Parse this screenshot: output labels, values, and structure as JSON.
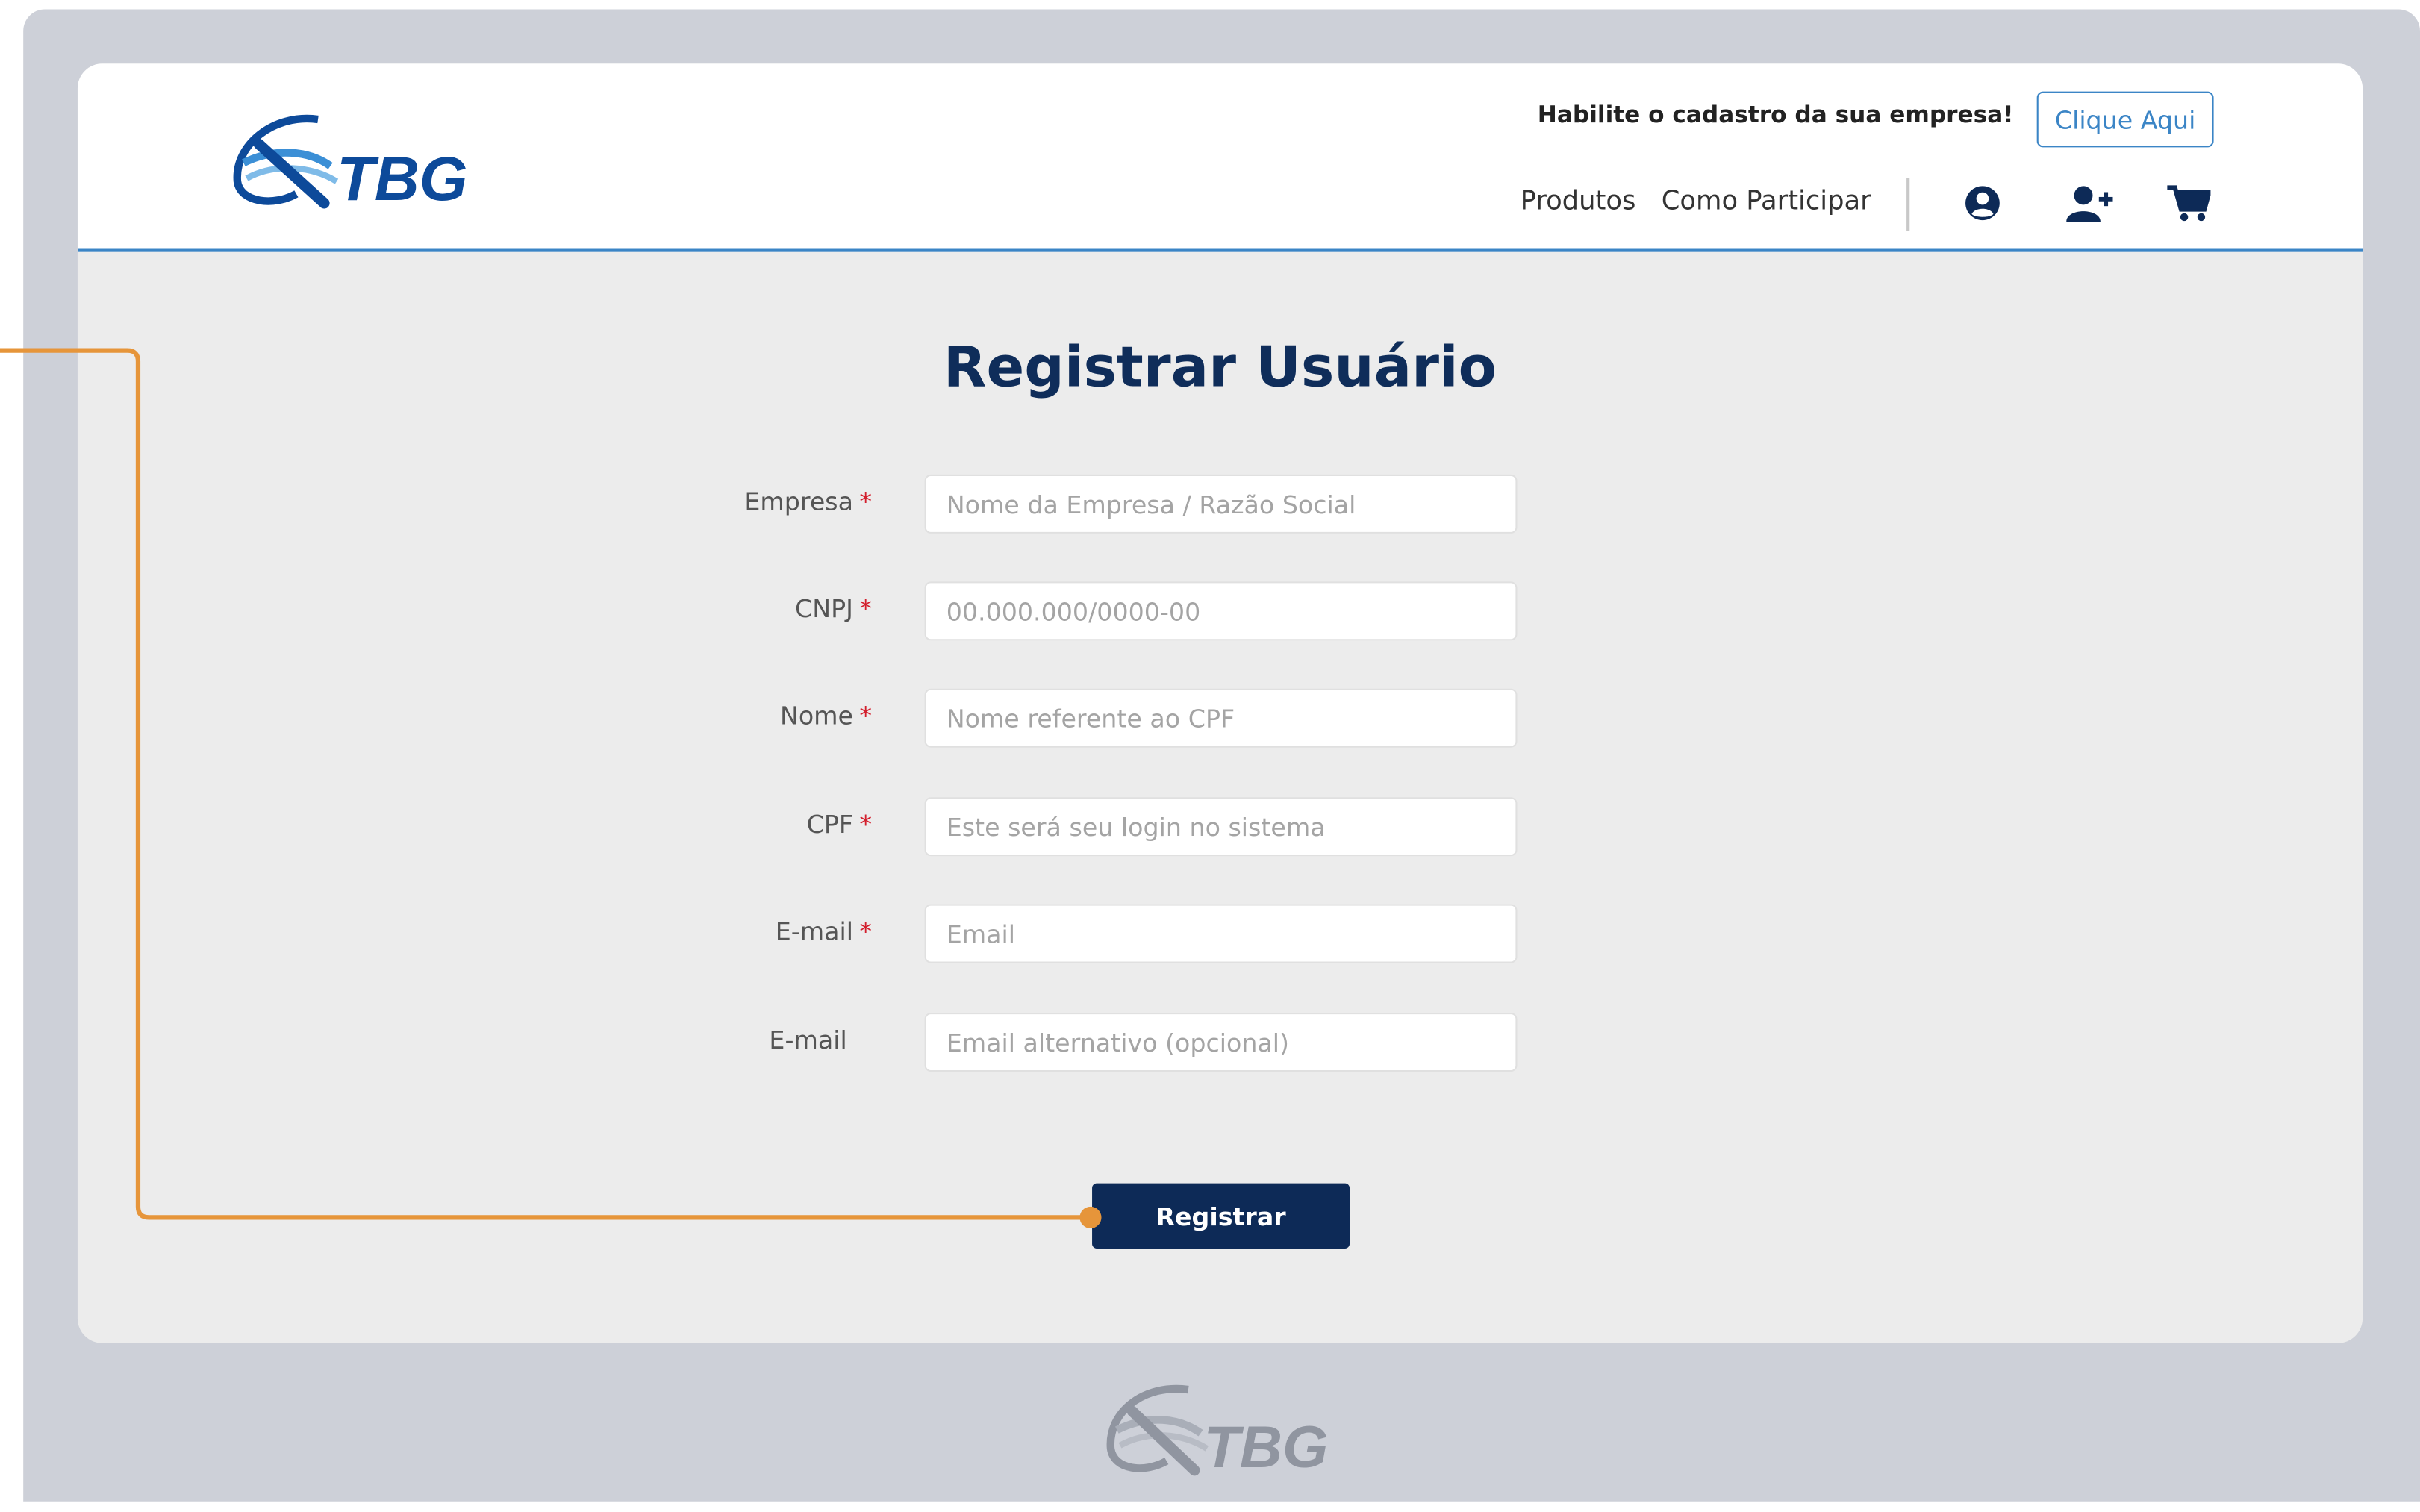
{
  "header": {
    "logo_text": "TBG",
    "promo_text": "Habilite o cadastro da sua empresa!",
    "promo_button": "Clique Aqui",
    "nav": [
      "Produtos",
      "Como Participar"
    ],
    "icons": [
      "user-circle-icon",
      "user-plus-icon",
      "cart-icon"
    ]
  },
  "form": {
    "title": "Registrar Usuário",
    "fields": [
      {
        "label": "Empresa",
        "required": true,
        "placeholder": "Nome da Empresa / Razão Social",
        "value": ""
      },
      {
        "label": "CNPJ",
        "required": true,
        "placeholder": "00.000.000/0000-00",
        "value": ""
      },
      {
        "label": "Nome",
        "required": true,
        "placeholder": "Nome referente ao CPF",
        "value": ""
      },
      {
        "label": "CPF",
        "required": true,
        "placeholder": "Este será seu login no sistema",
        "value": ""
      },
      {
        "label": "E-mail",
        "required": true,
        "placeholder": "Email",
        "value": ""
      },
      {
        "label": "E-mail",
        "required": false,
        "placeholder": "Email alternativo (opcional)",
        "value": ""
      }
    ],
    "required_marker": "*",
    "submit_label": "Registrar"
  },
  "footer": {
    "logo_text": "TBG"
  },
  "colors": {
    "brand_navy": "#0d2a57",
    "brand_blue": "#3b85c6",
    "required_red": "#d31f2d",
    "annotation_orange": "#e6953a",
    "frame_gray": "#cdd0d8"
  }
}
